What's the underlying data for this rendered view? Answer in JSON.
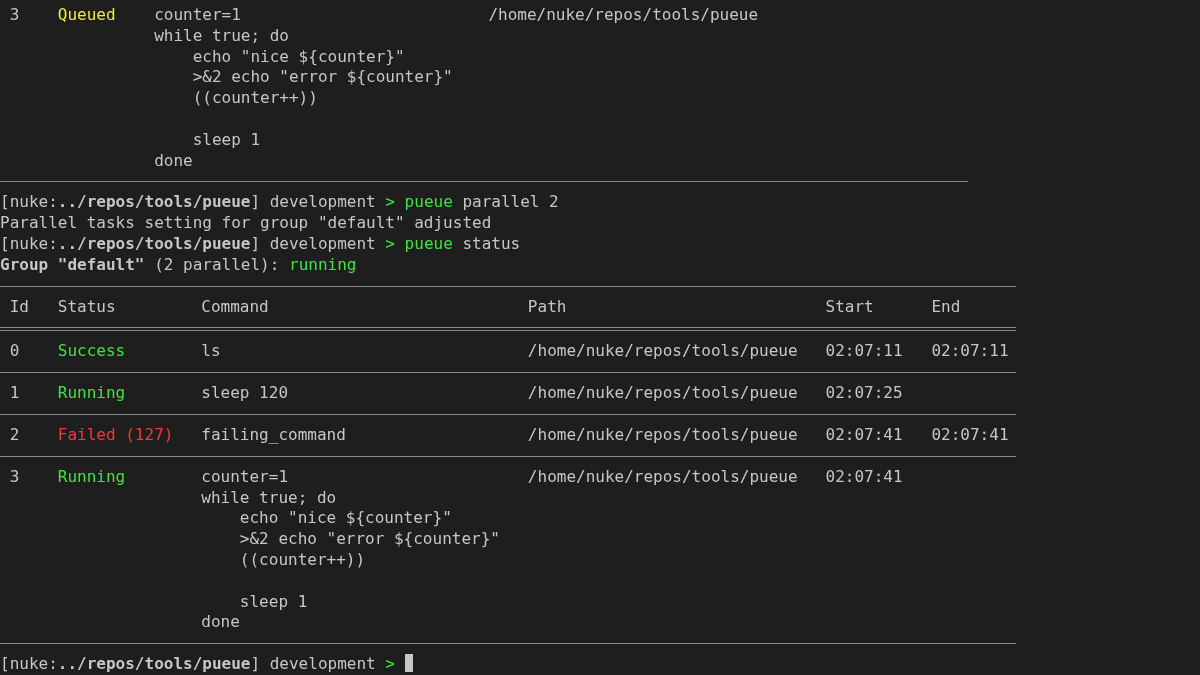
{
  "previous_table": {
    "rows": [
      {
        "id": "3",
        "status": "Queued",
        "color": "#ecec3c",
        "command": "counter=1\nwhile true; do\n    echo \"nice ${counter}\"\n    >&2 echo \"error ${counter}\"\n    ((counter++))\n\n    sleep 1\ndone",
        "path": "/home/nuke/repos/tools/pueue"
      }
    ]
  },
  "lines": [
    {
      "kind": "prompt",
      "prefix": "[nuke:",
      "cwd": "../repos/tools/pueue",
      "branch": "] development",
      "symbol": ">",
      "program": "pueue",
      "args": "parallel 2"
    },
    {
      "kind": "output",
      "text": "Parallel tasks setting for group \"default\" adjusted"
    },
    {
      "kind": "prompt",
      "prefix": "[nuke:",
      "cwd": "../repos/tools/pueue",
      "branch": "] development",
      "symbol": ">",
      "program": "pueue",
      "args": "status"
    },
    {
      "kind": "group",
      "text": "**Group \"default\"** (2 parallel): ",
      "status": "running"
    }
  ],
  "status_table": {
    "columns": [
      "Id",
      "Status",
      "Command",
      "Path",
      "Start",
      "End"
    ],
    "rows": [
      {
        "id": "0",
        "status": "Success",
        "color": "#3fe23f",
        "command": "ls",
        "path": "/home/nuke/repos/tools/pueue",
        "start": "02:07:11",
        "end": "02:07:11"
      },
      {
        "id": "1",
        "status": "Running",
        "color": "#3fe23f",
        "command": "sleep 120",
        "path": "/home/nuke/repos/tools/pueue",
        "start": "02:07:25"
      },
      {
        "id": "2",
        "status": "Failed (127)",
        "color": "#f03a3a",
        "command": "failing_command",
        "path": "/home/nuke/repos/tools/pueue",
        "start": "02:07:41",
        "end": "02:07:41"
      },
      {
        "id": "3",
        "status": "Running",
        "color": "#3fe23f",
        "command": "counter=1\nwhile true; do\n    echo \"nice ${counter}\"\n    >&2 echo \"error ${counter}\"\n    ((counter++))\n\n    sleep 1\ndone",
        "path": "/home/nuke/repos/tools/pueue",
        "start": "02:07:41"
      }
    ]
  },
  "final_prompt": {
    "prefix": "[nuke:",
    "cwd": "../repos/tools/pueue",
    "branch": "] development",
    "symbol": ">",
    "cursor": true
  }
}
